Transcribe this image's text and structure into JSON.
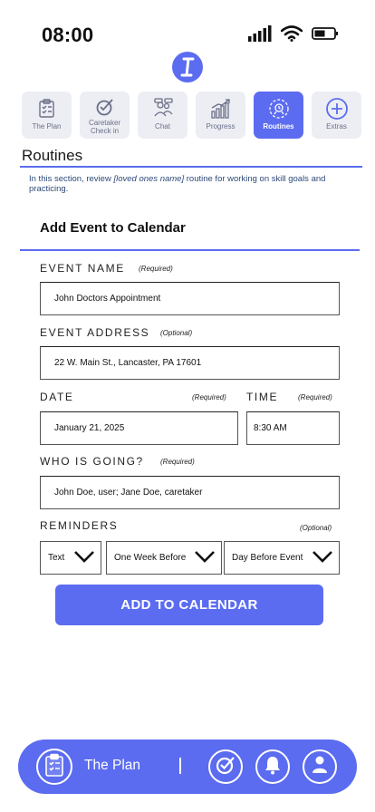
{
  "status_bar": {
    "time": "08:00"
  },
  "tabs": [
    {
      "label": "The Plan",
      "icon": "plan-icon",
      "active": false
    },
    {
      "label": "Caretaker Check in",
      "icon": "check-in-icon",
      "active": false
    },
    {
      "label": "Chat",
      "icon": "chat-icon",
      "active": false
    },
    {
      "label": "Progress",
      "icon": "progress-icon",
      "active": false
    },
    {
      "label": "Routines",
      "icon": "routines-icon",
      "active": true
    },
    {
      "label": "Extras",
      "icon": "plus-icon",
      "active": false
    }
  ],
  "section": {
    "title": "Routines",
    "desc_before": "In this section, review ",
    "desc_highlight": "[loved ones name]",
    "desc_after": " routine for working on skill goals and practicing."
  },
  "form": {
    "title": "Add Event to Calendar",
    "event_name": {
      "label": "EVENT NAME",
      "requirement": "(Required)",
      "value": "John Doctors Appointment"
    },
    "event_address": {
      "label": "EVENT ADDRESS",
      "requirement": "(Optional)",
      "value": "22 W. Main St., Lancaster, PA 17601"
    },
    "date": {
      "label": "DATE",
      "requirement": "(Required)",
      "value": "January 21, 2025"
    },
    "time": {
      "label": "TIME",
      "requirement": "(Required)",
      "value": "8:30 AM"
    },
    "who_going": {
      "label": "WHO IS GOING?",
      "requirement": "(Required)",
      "value": "John Doe, user;  Jane Doe, caretaker"
    },
    "reminders": {
      "label": "REMINDERS",
      "requirement": "(Optional)",
      "method": "Text",
      "first": "One Week Before",
      "second": "Day Before Event"
    },
    "submit_label": "ADD TO CALENDAR"
  },
  "bottom_nav": {
    "label": "The Plan"
  },
  "colors": {
    "accent": "#5b6cf0",
    "tab_bg": "#eceef4",
    "desc_text": "#2d4a7a"
  }
}
